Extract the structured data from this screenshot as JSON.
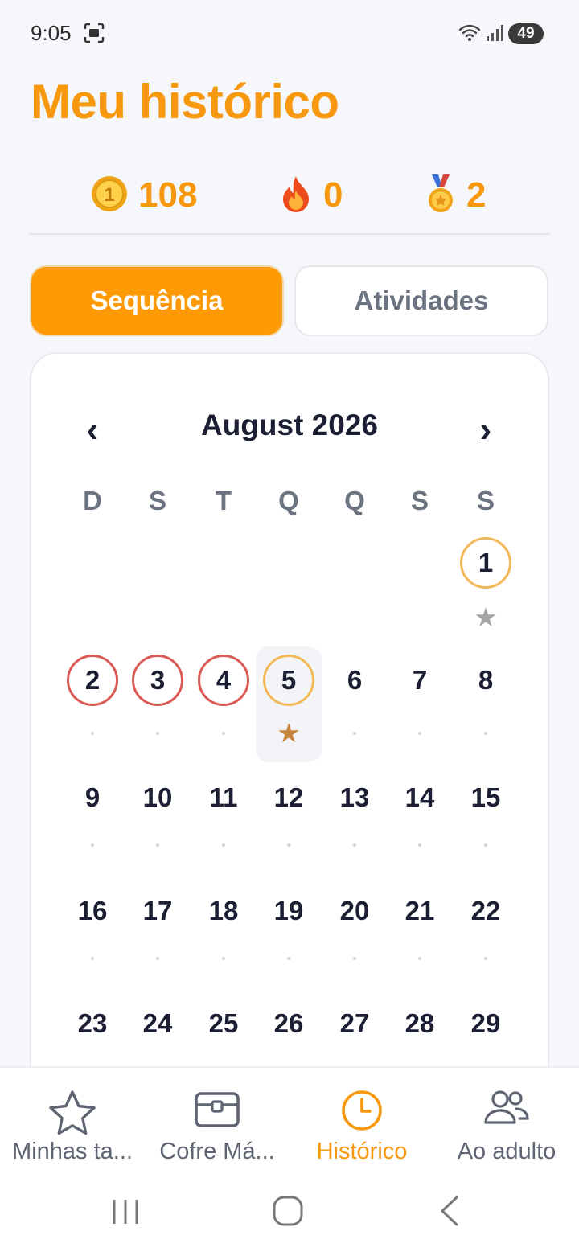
{
  "status_bar": {
    "time": "9:05",
    "battery": "49"
  },
  "page": {
    "title": "Meu histórico"
  },
  "stats": {
    "coins": "108",
    "streak": "0",
    "medals": "2"
  },
  "tabs": {
    "sequence": "Sequência",
    "activities": "Atividades",
    "selected": "Sequência"
  },
  "calendar": {
    "month_label": "August 2026",
    "prev_label": "‹",
    "next_label": "›",
    "weekdays": [
      "D",
      "S",
      "T",
      "Q",
      "Q",
      "S",
      "S"
    ],
    "days": [
      {
        "n": "1",
        "status": "done",
        "mark": "gray-star"
      },
      {
        "n": "2",
        "status": "missed",
        "mark": "dot"
      },
      {
        "n": "3",
        "status": "missed",
        "mark": "dot"
      },
      {
        "n": "4",
        "status": "missed",
        "mark": "dot"
      },
      {
        "n": "5",
        "status": "today",
        "mark": "bronze-star"
      },
      {
        "n": "6",
        "status": "none",
        "mark": "dot"
      },
      {
        "n": "7",
        "status": "none",
        "mark": "dot"
      },
      {
        "n": "8",
        "status": "none",
        "mark": "dot"
      },
      {
        "n": "9",
        "status": "none",
        "mark": "dot"
      },
      {
        "n": "10",
        "status": "none",
        "mark": "dot"
      },
      {
        "n": "11",
        "status": "none",
        "mark": "dot"
      },
      {
        "n": "12",
        "status": "none",
        "mark": "dot"
      },
      {
        "n": "13",
        "status": "none",
        "mark": "dot"
      },
      {
        "n": "14",
        "status": "none",
        "mark": "dot"
      },
      {
        "n": "15",
        "status": "none",
        "mark": "dot"
      },
      {
        "n": "16",
        "status": "none",
        "mark": "dot"
      },
      {
        "n": "17",
        "status": "none",
        "mark": "dot"
      },
      {
        "n": "18",
        "status": "none",
        "mark": "dot"
      },
      {
        "n": "19",
        "status": "none",
        "mark": "dot"
      },
      {
        "n": "20",
        "status": "none",
        "mark": "dot"
      },
      {
        "n": "21",
        "status": "none",
        "mark": "dot"
      },
      {
        "n": "22",
        "status": "none",
        "mark": "dot"
      },
      {
        "n": "23",
        "status": "none",
        "mark": "none"
      },
      {
        "n": "24",
        "status": "none",
        "mark": "none"
      },
      {
        "n": "25",
        "status": "none",
        "mark": "none"
      },
      {
        "n": "26",
        "status": "none",
        "mark": "none"
      },
      {
        "n": "27",
        "status": "none",
        "mark": "none"
      },
      {
        "n": "28",
        "status": "none",
        "mark": "none"
      },
      {
        "n": "29",
        "status": "none",
        "mark": "none"
      }
    ]
  },
  "nav": {
    "items": [
      {
        "label": "Minhas ta...",
        "icon": "star-icon"
      },
      {
        "label": "Cofre Má...",
        "icon": "chest-icon"
      },
      {
        "label": "Histórico",
        "icon": "clock-icon"
      },
      {
        "label": "Ao adulto",
        "icon": "users-icon"
      }
    ],
    "active": "Histórico"
  },
  "colors": {
    "accent": "#f7980e",
    "ring_orange": "#f4b957",
    "ring_red": "#db5a55",
    "star_bronze": "#c7853b",
    "star_gray": "#a6a6a6"
  }
}
